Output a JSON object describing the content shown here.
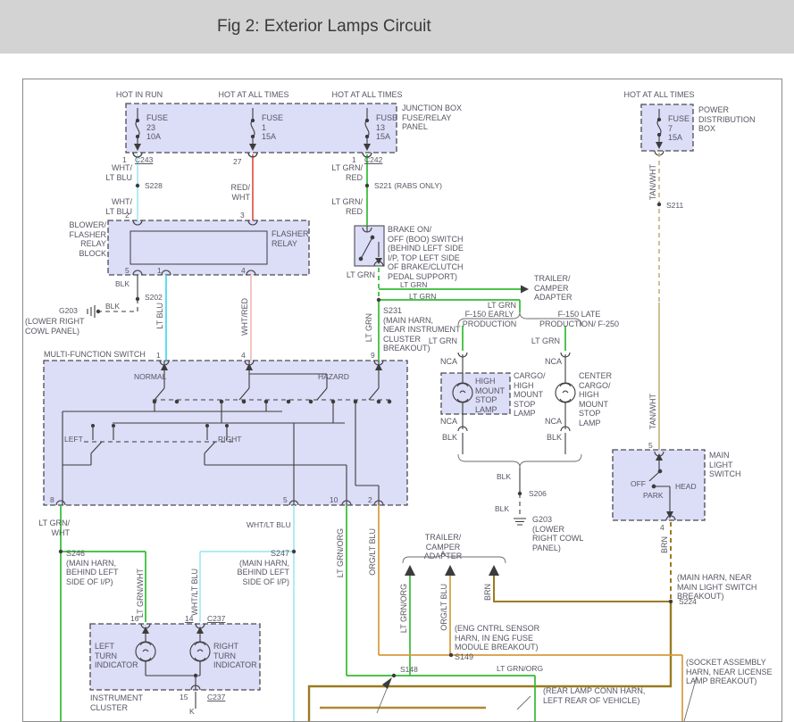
{
  "title": "Fig 2: Exterior Lamps Circuit",
  "colors": {
    "titlebar_bg": "#d3d3d3",
    "box_fill": "#dcddf6",
    "box_border": "#4a4a55",
    "wire_black": "#3c3c3c",
    "wire_wht_lt_blu": "#a5e8f1",
    "wire_lt_blu": "#3fd9ea",
    "wire_red_wht": "#e0524a",
    "wire_wht_red": "#f2bcb8",
    "wire_lt_grn": "#33bb33",
    "wire_tan_wht": "#c9b381",
    "wire_brn": "#9a7b20",
    "wire_brn_lt": "#ad8a33",
    "wire_org_lt_blu": "#d79a3c"
  },
  "labels": {
    "hot_in_run": "HOT IN RUN",
    "hot_at_all_times": "HOT AT ALL TIMES",
    "junction_box": "JUNCTION BOX\nFUSE/RELAY\nPANEL",
    "power_distribution_box": "POWER\nDISTRIBUTION\nBOX",
    "fuse_23": "FUSE\n23\n10A",
    "fuse_1": "FUSE\n1\n15A",
    "fuse_13": "FUSE\n13\n15A",
    "fuse_7": "FUSE\n7\n15A",
    "pin_1": "1",
    "pin_2": "2",
    "pin_3": "3",
    "pin_4": "4",
    "pin_5": "5",
    "pin_8": "8",
    "pin_9": "9",
    "pin_10": "10",
    "pin_14": "14",
    "pin_15": "15",
    "pin_16": "16",
    "pin_27": "27",
    "conn_c243": "C243",
    "conn_c242": "C242",
    "conn_c237": "C237",
    "wht_lt_blu_2line": "WHT/\nLT BLU",
    "wht_lt_blu": "WHT/LT BLU",
    "red_wht_2line": "RED/\nWHT",
    "lt_grn_red_2line": "LT GRN/\nRED",
    "s228": "S228",
    "s221_rabs": "S221 (RABS ONLY)",
    "s211": "S211",
    "s202": "S202",
    "s206": "S206",
    "s224": "S224",
    "s148": "S148",
    "tan_wht": "TAN/WHT",
    "blower_flasher_relay_block": "BLOWER/\nFLASHER\nRELAY\nBLOCK",
    "flasher_relay": "FLASHER\nRELAY",
    "blk": "BLK",
    "g203": "G203",
    "lower_right_cowl_2line": "(LOWER RIGHT\nCOWL PANEL)",
    "lt_blu": "LT BLU",
    "wht_red": "WHT/RED",
    "boo_switch": "BRAKE ON/\nOFF (BOO) SWITCH\n(BEHIND LEFT SIDE\nI/P, TOP LEFT SIDE\nOF BRAKE/CLUTCH\nPEDAL SUPPORT)",
    "lt_grn": "LT GRN",
    "trailer_camper_adapter": "TRAILER/\nCAMPER\nADAPTER",
    "s231_block": "S231\n(MAIN HARN,\nNEAR INSTRUMENT\nCLUSTER\nBREAKOUT)",
    "f150_early": "F-150 EARLY\nPRODUCTION",
    "f150_late": "F-150 LATE\nPRODUCTION/ F-250",
    "nca": "NCA",
    "high_mount_stop_lamp": "HIGH\nMOUNT\nSTOP\nLAMP",
    "cargo_high_mount": "CARGO/\nHIGH\nMOUNT\nSTOP\nLAMP",
    "center_cargo_high_mount": "CENTER\nCARGO/\nHIGH\nMOUNT\nSTOP\nLAMP",
    "g203_lower_right_cowl": "G203\n(LOWER\nRIGHT COWL\nPANEL)",
    "main_light_switch": "MAIN\nLIGHT\nSWITCH",
    "off": "OFF",
    "park": "PARK",
    "head": "HEAD",
    "brn": "BRN",
    "s224_note": "(MAIN HARN, NEAR\nMAIN LIGHT SWITCH\nBREAKOUT)",
    "multi_function_switch": "MULTI-FUNCTION SWITCH",
    "normal": "NORMAL",
    "hazard": "HAZARD",
    "left": "LEFT",
    "right": "RIGHT",
    "lt_grn_wht_2line": "LT GRN/\nWHT",
    "lt_grn_wht": "LT GRN/WHT",
    "s246_block": "S246\n(MAIN HARN,\nBEHIND LEFT\nSIDE OF I/P)",
    "s247_block": "S247\n(MAIN HARN,\nBEHIND LEFT\nSIDE OF I/P)",
    "left_turn_indicator": "LEFT\nTURN\nINDICATOR",
    "right_turn_indicator": "RIGHT\nTURN\nINDICATOR",
    "instrument_cluster": "INSTRUMENT\nCLUSTER",
    "k": "K",
    "lt_grn_org": "LT GRN/ORG",
    "org_lt_blu": "ORG/LT BLU",
    "s149_block": "(ENG CNTRL SENSOR\nHARN, IN ENG FUSE\nMODULE BREAKOUT)\nS149",
    "rear_lamp_note": "(REAR LAMP CONN HARN,\nLEFT REAR OF VEHICLE)",
    "socket_note": "(SOCKET ASSEMBLY\nHARN, NEAR LICENSE\nLAMP BREAKOUT)"
  }
}
